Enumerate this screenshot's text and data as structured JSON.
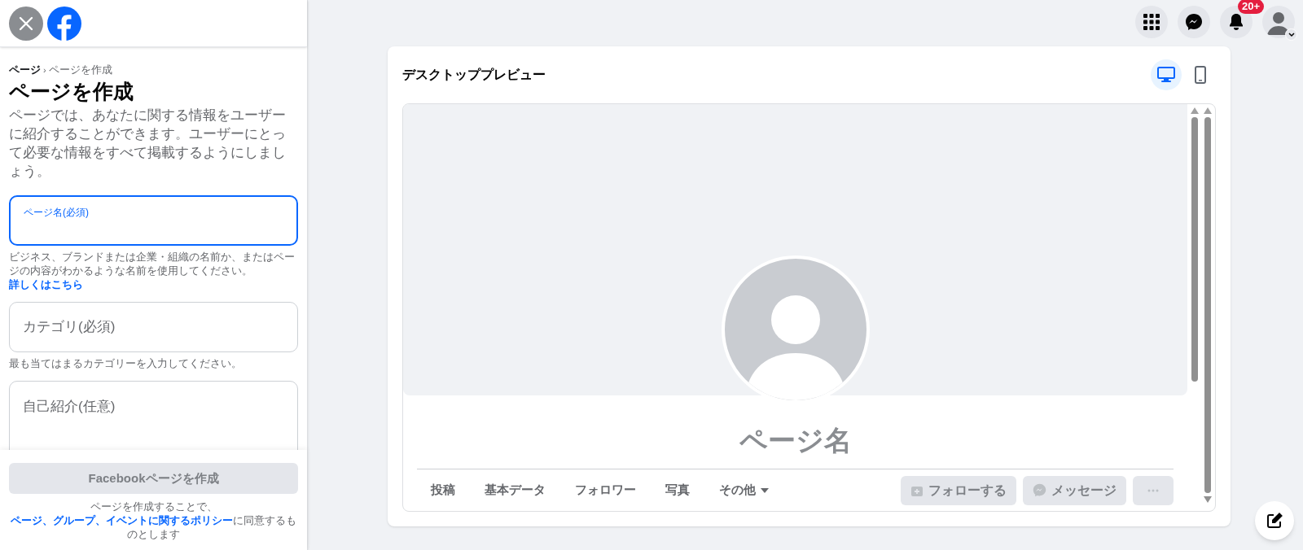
{
  "breadcrumb": {
    "parent": "ページ",
    "separator": "›",
    "current": "ページを作成"
  },
  "title": "ページを作成",
  "description": "ページでは、あなたに関する情報をユーザーに紹介することができます。ユーザーにとって必要な情報をすべて掲載するようにしましょう。",
  "fields": [
    {
      "kind": "input",
      "label": "ページ名(必須)",
      "focused": true,
      "helper": "ビジネス、ブランドまたは企業・組織の名前か、またはページの内容がわかるような名前を使用してください。",
      "helper_link": "詳しくはこちら"
    },
    {
      "kind": "input",
      "label": "カテゴリ(必須)",
      "focused": false,
      "helper": "最も当てはまるカテゴリーを入力してください。"
    },
    {
      "kind": "textarea",
      "label": "自己紹介(任意)",
      "focused": false
    }
  ],
  "submit_button": {
    "label": "Facebookページを作成",
    "disabled": true
  },
  "policy": {
    "prefix": "ページを作成することで、",
    "link": "ページ、グループ、イベントに関するポリシー",
    "suffix": "に同意するものとします"
  },
  "top_bar": {
    "notification_count": "20+"
  },
  "preview": {
    "title": "デスクトッププレビュー",
    "modes": [
      {
        "kind": "desktop",
        "selected": true
      },
      {
        "kind": "mobile",
        "selected": false
      }
    ],
    "page_name": "ページ名",
    "tabs": [
      {
        "label": "投稿",
        "has_menu": false
      },
      {
        "label": "基本データ",
        "has_menu": false
      },
      {
        "label": "フォロワー",
        "has_menu": false
      },
      {
        "label": "写真",
        "has_menu": false
      },
      {
        "label": "その他",
        "has_menu": true
      }
    ],
    "actions": [
      {
        "kind": "follow",
        "label": "フォローする",
        "disabled": true
      },
      {
        "kind": "message",
        "label": "メッセージ",
        "disabled": true
      },
      {
        "kind": "more",
        "disabled": true
      }
    ]
  }
}
